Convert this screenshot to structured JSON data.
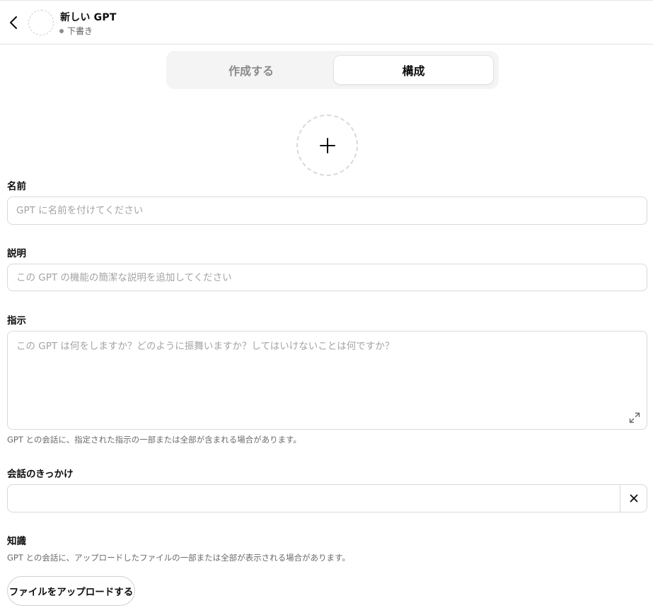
{
  "header": {
    "title": "新しい GPT",
    "status": "下書き"
  },
  "tabs": [
    {
      "label": "作成する",
      "active": false
    },
    {
      "label": "構成",
      "active": true
    }
  ],
  "form": {
    "name": {
      "label": "名前",
      "placeholder": "GPT に名前を付けてください",
      "value": ""
    },
    "description": {
      "label": "説明",
      "placeholder": "この GPT の機能の簡潔な説明を追加してください",
      "value": ""
    },
    "instructions": {
      "label": "指示",
      "placeholder": "この GPT は何をしますか？どのように振舞いますか？してはいけないことは何ですか？",
      "value": "",
      "helper": "GPT との会話に、指定された指示の一部または全部が含まれる場合があります。"
    },
    "conversation_starters": {
      "label": "会話のきっかけ",
      "value": ""
    },
    "knowledge": {
      "label": "知識",
      "helper": "GPT との会話に、アップロードしたファイルの一部または全部が表示される場合があります。",
      "upload_button": "ファイルをアップロードする"
    }
  },
  "icons": {
    "back": "chevron-left-icon",
    "avatar_add": "plus-icon",
    "expand": "expand-icon",
    "remove": "close-icon"
  }
}
